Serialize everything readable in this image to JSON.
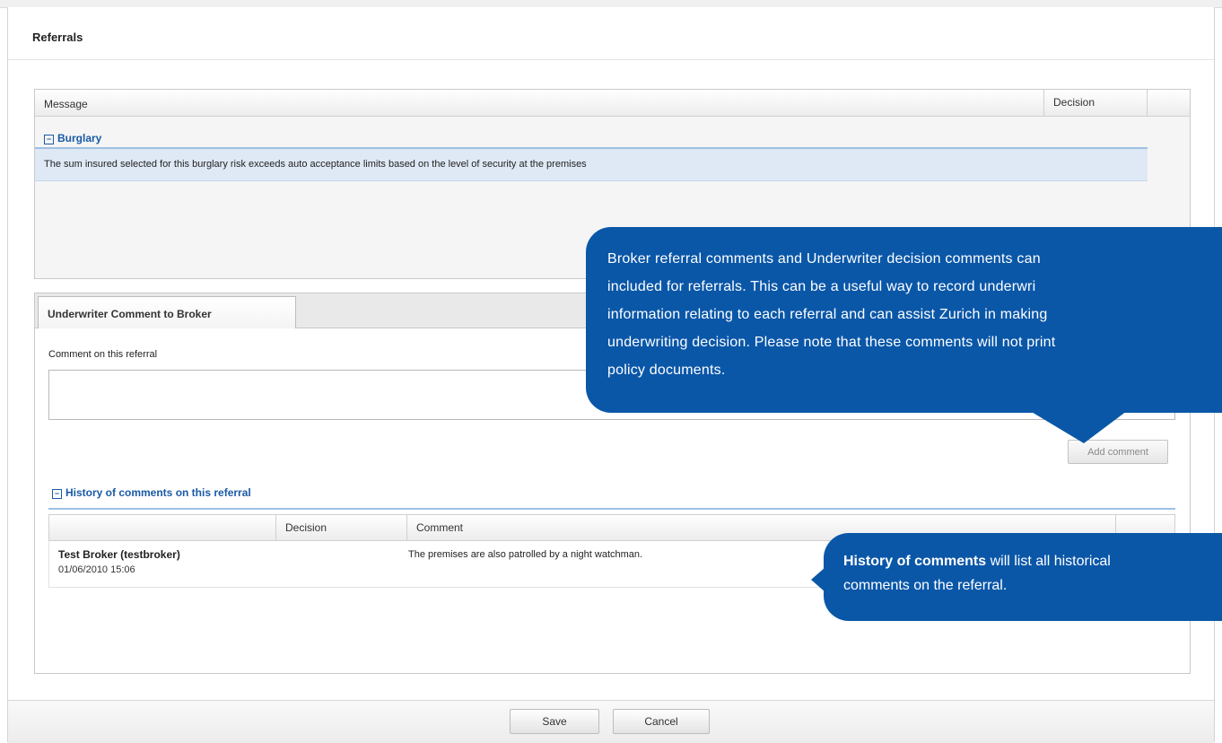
{
  "page": {
    "title": "Referrals"
  },
  "referral_grid": {
    "columns": {
      "message": "Message",
      "decision": "Decision"
    },
    "groups": [
      {
        "name": "Burglary",
        "rows": [
          {
            "message": "The sum insured selected for this burglary risk exceeds auto acceptance limits based on the level of security at the premises"
          }
        ]
      }
    ]
  },
  "comment_panel": {
    "tab_label": "Underwriter Comment to Broker",
    "field_label": "Comment on this referral",
    "field_value": "",
    "add_button": "Add comment"
  },
  "history": {
    "title": "History of comments on this referral",
    "columns": {
      "user": "",
      "decision": "Decision",
      "comment": "Comment"
    },
    "rows": [
      {
        "user": "Test Broker (testbroker)",
        "date": "01/06/2010 15:06",
        "decision": "",
        "comment": "The premises are also patrolled by a night watchman."
      }
    ]
  },
  "callouts": {
    "comments_tip_lines": [
      "Broker referral comments and Underwriter decision comments can",
      "included for referrals. This can be a useful way to record underwri",
      "information relating to each referral and can assist Zurich in making",
      "underwriting decision. Please note that these comments will not print",
      "policy documents."
    ],
    "history_tip_bold": "History of comments",
    "history_tip_rest": " will list all historical",
    "history_tip_line2": "comments on the referral."
  },
  "footer": {
    "save": "Save",
    "cancel": "Cancel"
  },
  "colors": {
    "callout_blue": "#0a57a8",
    "group_blue": "#1a5aa6",
    "selected_row": "#dfe9f6"
  }
}
